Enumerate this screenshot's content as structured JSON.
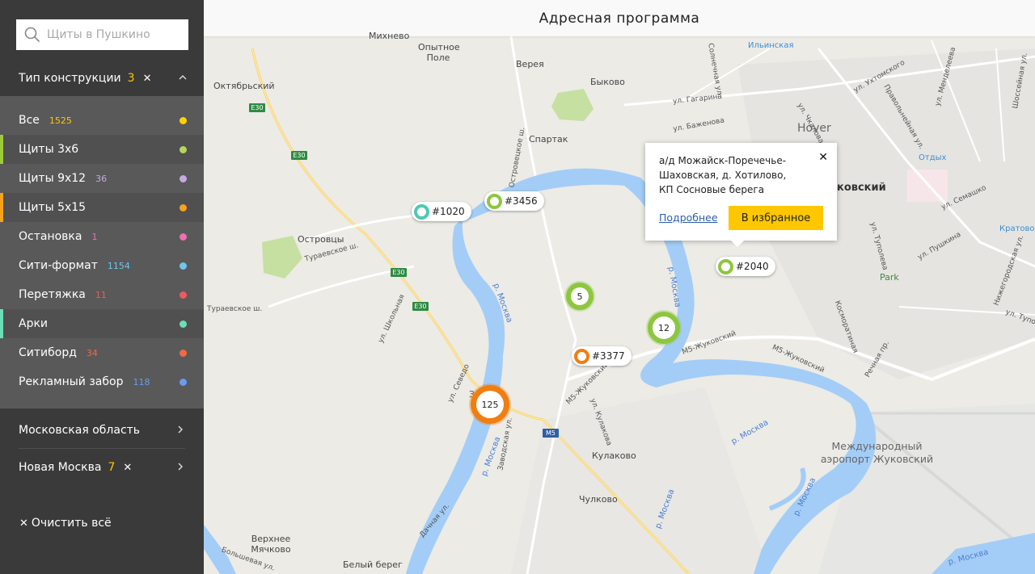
{
  "search": {
    "placeholder": "Щиты в Пушкино"
  },
  "filter": {
    "title": "Тип конструкции",
    "count": "3",
    "clear_icon": "close-icon",
    "toggle_icon": "chevron-up-icon"
  },
  "options": [
    {
      "label": "Все",
      "count": "1525",
      "count_color": "#ffc700",
      "dot_color": "#ffd300",
      "active": false,
      "bar_color": ""
    },
    {
      "label": "Щиты 3х6",
      "count": "",
      "count_color": "",
      "dot_color": "#b5d65a",
      "active": true,
      "bar_color": "#9dcc3a"
    },
    {
      "label": "Щиты 9х12",
      "count": "36",
      "count_color": "#c6a9e0",
      "dot_color": "#c6a9e0",
      "active": false,
      "bar_color": ""
    },
    {
      "label": "Щиты 5х15",
      "count": "",
      "count_color": "",
      "dot_color": "#f7a21b",
      "active": true,
      "bar_color": "#f7a21b"
    },
    {
      "label": "Остановка",
      "count": "1",
      "count_color": "#ef6fb2",
      "dot_color": "#ef6fb2",
      "active": false,
      "bar_color": ""
    },
    {
      "label": "Сити-формат",
      "count": "1154",
      "count_color": "#6dc7ef",
      "dot_color": "#6dc7ef",
      "active": false,
      "bar_color": ""
    },
    {
      "label": "Перетяжка",
      "count": "11",
      "count_color": "#ee5a63",
      "dot_color": "#ee5a63",
      "active": false,
      "bar_color": ""
    },
    {
      "label": "Арки",
      "count": "",
      "count_color": "",
      "dot_color": "#6cdeb8",
      "active": true,
      "bar_color": "#6cdeb8"
    },
    {
      "label": "Ситиборд",
      "count": "34",
      "count_color": "#f06a45",
      "dot_color": "#f06a45",
      "active": false,
      "bar_color": ""
    },
    {
      "label": "Рекламный забор",
      "count": "118",
      "count_color": "#6a9cef",
      "dot_color": "#6a9cef",
      "active": false,
      "bar_color": ""
    }
  ],
  "regions": [
    {
      "label": "Московская область",
      "count": ""
    },
    {
      "label": "Новая Москва",
      "count": "7"
    }
  ],
  "clear_all": "Очистить всё",
  "map": {
    "title": "Адресная программа",
    "labels": [
      "Михнево",
      "Опытное Поле",
      "Верея",
      "Быково",
      "Октябрьский",
      "Спартак",
      "Островцы",
      "Кулаково",
      "Чулково",
      "Верхнее Мячково",
      "Белый берег",
      "Международный аэропорт Жуковский",
      "Hover",
      "ковский",
      "Ильинская",
      "Отдых",
      "Кратово",
      "Park",
      "ул. Гагарина",
      "ул. Баженова",
      "Правольнейная ул.",
      "Шоссейная ул.",
      "ул. Чкалова",
      "Солнечная ул.",
      "ул. Менделеева",
      "ул. Ухтомского",
      "Островецкое ш.",
      "Тураевское ш.",
      "Тураевское ш.",
      "ул. Школьная",
      "ул. Севедо",
      "ул. Кулакова",
      "Дачная ул.",
      "Заводская ул.",
      "ул. Семашко",
      "ул. Туполева",
      "ул. Пушкина",
      "Нижегородская ул.",
      "Косморатиная",
      "Речная пр.",
      "ул. Туполева",
      "М5-Жуковский",
      "М5-Жуковский",
      "М5-Жуковский",
      "р. Москва",
      "р. Москва",
      "р. Москва",
      "р. Москва",
      "р. Москва",
      "р. Москва",
      "р. Москва",
      "Большевая ул.",
      "Зап"
    ],
    "road_shields": [
      "E30",
      "E30",
      "E30",
      "E30",
      "M5"
    ],
    "pins": [
      {
        "label": "#1020",
        "color": "#4fc9b0"
      },
      {
        "label": "#3456",
        "color": "#8dc63f"
      },
      {
        "label": "#2040",
        "color": "#8dc63f"
      },
      {
        "label": "#3377",
        "color": "#f07e10"
      }
    ],
    "clusters": [
      {
        "count": "5",
        "color": "#8dc63f"
      },
      {
        "count": "12",
        "color": "#8dc63f"
      },
      {
        "count": "125",
        "color": "#f07e10"
      }
    ],
    "popup": {
      "address": [
        "а/д Можайск-Поречечье-",
        "Шаховская, д. Хотилово,",
        "КП Сосновые берега"
      ],
      "more": "Подробнее",
      "favorite": "В избранное",
      "close_icon": "close-icon"
    }
  }
}
